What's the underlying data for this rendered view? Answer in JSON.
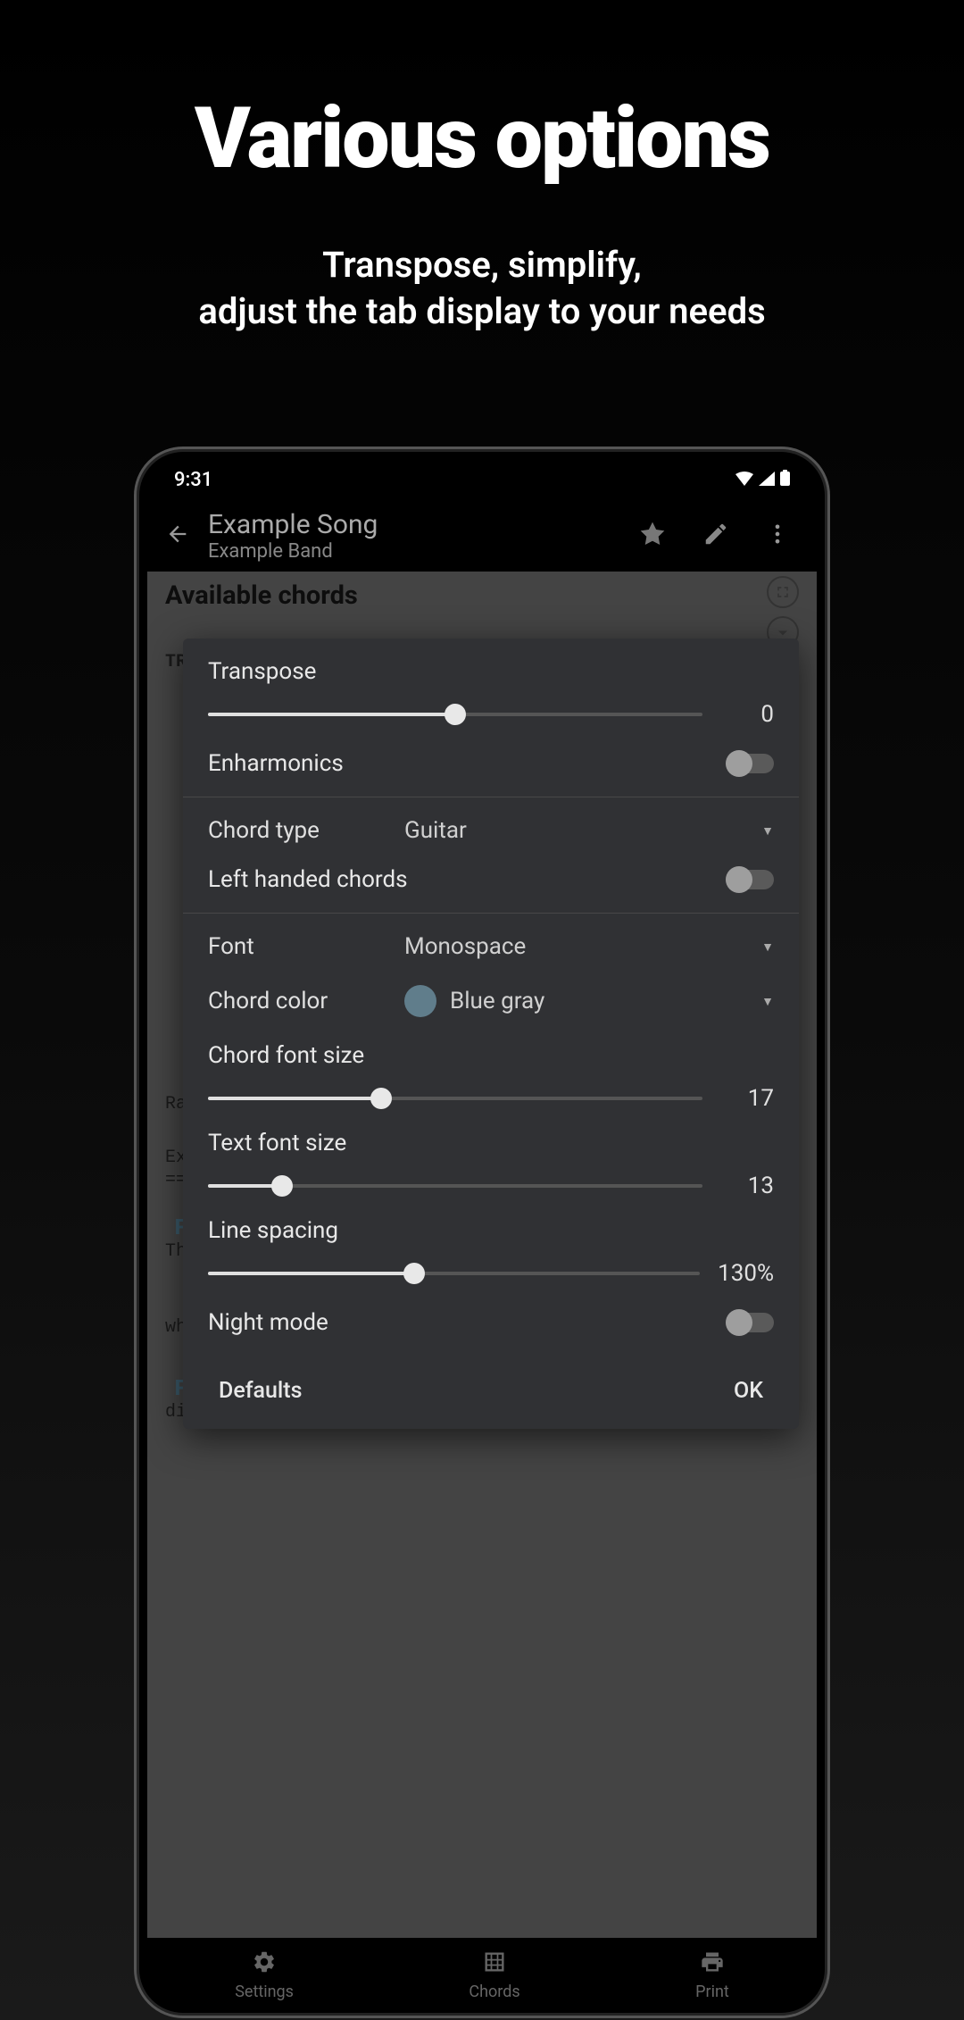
{
  "promo": {
    "title": "Various options",
    "subtitle_line1": "Transpose, simplify,",
    "subtitle_line2": "adjust the tab display to your needs"
  },
  "status_bar": {
    "time": "9:31"
  },
  "header": {
    "song_title": "Example Song",
    "band_name": "Example Band"
  },
  "content": {
    "section_title": "Available chords",
    "truncated_label": "TR",
    "bg_ra": "Ra",
    "bg_ex": "Ex",
    "bg_eq": "==",
    "bg_th": "Th",
    "bg_wh": "wh",
    "bg_chord_f": "F",
    "bg_chord_c": "C",
    "bg_line": "different chords which can"
  },
  "dialog": {
    "transpose": {
      "label": "Transpose",
      "value": "0",
      "slider_percent": 50
    },
    "enharmonics": {
      "label": "Enharmonics",
      "enabled": false
    },
    "chord_type": {
      "label": "Chord type",
      "value": "Guitar"
    },
    "left_handed": {
      "label": "Left handed chords",
      "enabled": false
    },
    "font": {
      "label": "Font",
      "value": "Monospace"
    },
    "chord_color": {
      "label": "Chord color",
      "value": "Blue gray",
      "hex": "#607d8b"
    },
    "chord_font_size": {
      "label": "Chord font size",
      "value": "17",
      "slider_percent": 35
    },
    "text_font_size": {
      "label": "Text font size",
      "value": "13",
      "slider_percent": 15
    },
    "line_spacing": {
      "label": "Line spacing",
      "value": "130%",
      "slider_percent": 42
    },
    "night_mode": {
      "label": "Night mode",
      "enabled": false
    },
    "actions": {
      "defaults": "Defaults",
      "ok": "OK"
    }
  },
  "bottom_nav": {
    "settings": "Settings",
    "chords": "Chords",
    "print": "Print"
  }
}
